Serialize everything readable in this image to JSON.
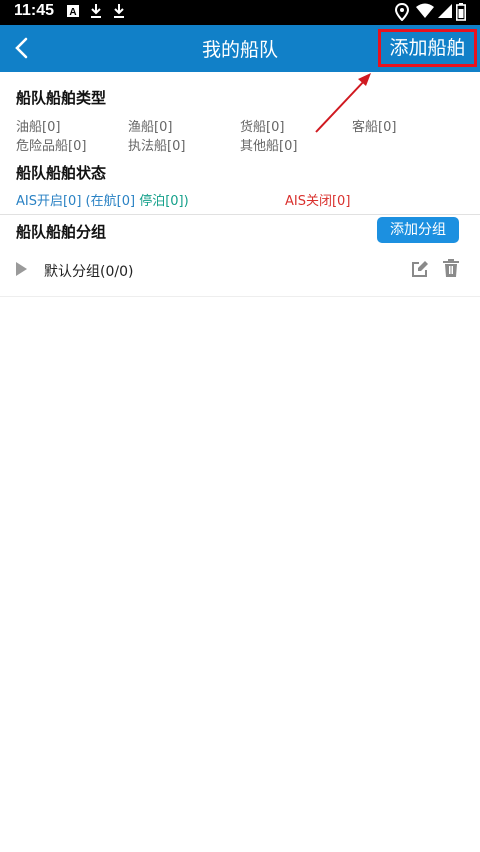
{
  "status_bar": {
    "time": "11:45",
    "left_icons": [
      "font-a-icon",
      "download-icon",
      "download-icon"
    ],
    "right_icons": [
      "location-icon",
      "wifi-icon",
      "signal-icon",
      "battery-icon"
    ]
  },
  "app_bar": {
    "back_icon": "chevron-left-icon",
    "title": "我的船队",
    "action_label": "添加船舶",
    "color": "#1180c8",
    "highlight_color": "#e8121e"
  },
  "vessel_types": {
    "title": "船队船舶类型",
    "items": [
      {
        "label": "油船[0]"
      },
      {
        "label": "渔船[0]"
      },
      {
        "label": "货船[0]"
      },
      {
        "label": "客船[0]"
      },
      {
        "label": "危险品船[0]"
      },
      {
        "label": "执法船[0]"
      },
      {
        "label": "其他船[0]"
      }
    ]
  },
  "vessel_status": {
    "title": "船队船舶状态",
    "ais_on": "AIS开启[0]",
    "underway": "(在航[0]",
    "moored": "停泊[0])",
    "ais_off": "AIS关闭[0]",
    "colors": {
      "ais_on": "#2a82c4",
      "underway": "#2a82c4",
      "moored": "#14a08a",
      "ais_off": "#d9312e"
    }
  },
  "groups": {
    "title": "船队船舶分组",
    "add_button": "添加分组",
    "items": [
      {
        "name": "默认分组(0/0)",
        "edit_icon": "edit-icon",
        "delete_icon": "trash-icon"
      }
    ]
  }
}
